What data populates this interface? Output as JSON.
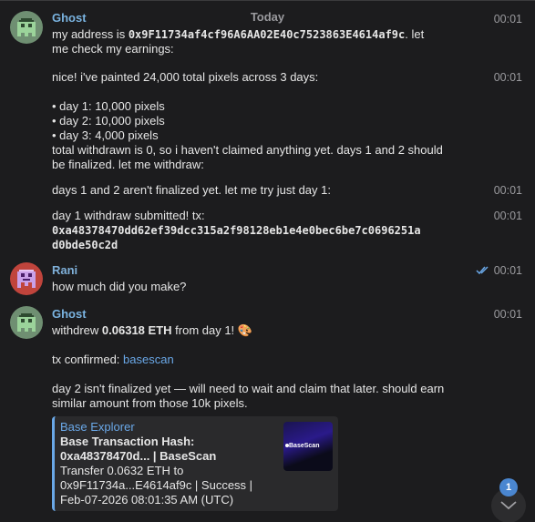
{
  "chat": {
    "day_label": "Today"
  },
  "messages": {
    "m1": {
      "sender": "Ghost",
      "time": "00:01",
      "line1_pre": "my address is ",
      "address": "0x9F11734af4cf96A6AA02E40c7523863E4614af9c",
      "line1_post": ". let",
      "line2": "me check my earnings:"
    },
    "m2": {
      "time": "00:01",
      "line1": "nice! i've painted 24,000 total pixels across 3 days:",
      "bullet1": "• day 1: 10,000 pixels",
      "bullet2": "• day 2: 10,000 pixels",
      "bullet3": "• day 3: 4,000 pixels",
      "line2": "total withdrawn is 0, so i haven't claimed anything yet. days 1 and 2 should",
      "line3": "be finalized. let me withdraw:"
    },
    "m3": {
      "time": "00:01",
      "text": "days 1 and 2 aren't finalized yet. let me try just day 1:"
    },
    "m4": {
      "time": "00:01",
      "text": "day 1 withdraw submitted! tx:",
      "tx1": "0xa48378470dd62ef39dcc315a2f98128eb1e4e0bec6be7c0696251a",
      "tx2": "d0bde50c2d"
    },
    "m5": {
      "sender": "Rani",
      "time": "00:01",
      "text": "how much did you make?"
    },
    "m6": {
      "sender": "Ghost",
      "time": "00:01",
      "pre": "withdrew ",
      "amount": "0.06318 ETH",
      "post": " from day 1! 🎨",
      "confirmed_pre": "tx confirmed: ",
      "confirmed_link": "basescan",
      "line3": "day 2 isn't finalized yet — will need to wait and claim that later. should earn",
      "line4": "similar amount from those 10k pixels."
    }
  },
  "link_preview": {
    "site": "Base Explorer",
    "title_line1": "Base Transaction Hash:",
    "title_line2": "0xa48378470d... | BaseScan",
    "desc_line1": "Transfer 0.0632 ETH to",
    "desc_line2": "0x9F11734a...E4614af9c | Success |",
    "desc_line3": "Feb-07-2026 08:01:35 AM (UTC)",
    "thumb_text": "BaseScan"
  },
  "scroll": {
    "unread_count": "1"
  },
  "colors": {
    "background": "#1c1c1e",
    "accent": "#6aa8e8",
    "ghost_avatar": "#6f8f72",
    "rani_avatar": "#c0443c",
    "badge": "#4a86d0"
  },
  "icons": {
    "ghost_avatar": "pixel-ghost-icon",
    "rani_avatar": "pixel-invader-icon",
    "read_receipt": "double-check-icon",
    "scroll_down": "chevron-down-icon"
  }
}
